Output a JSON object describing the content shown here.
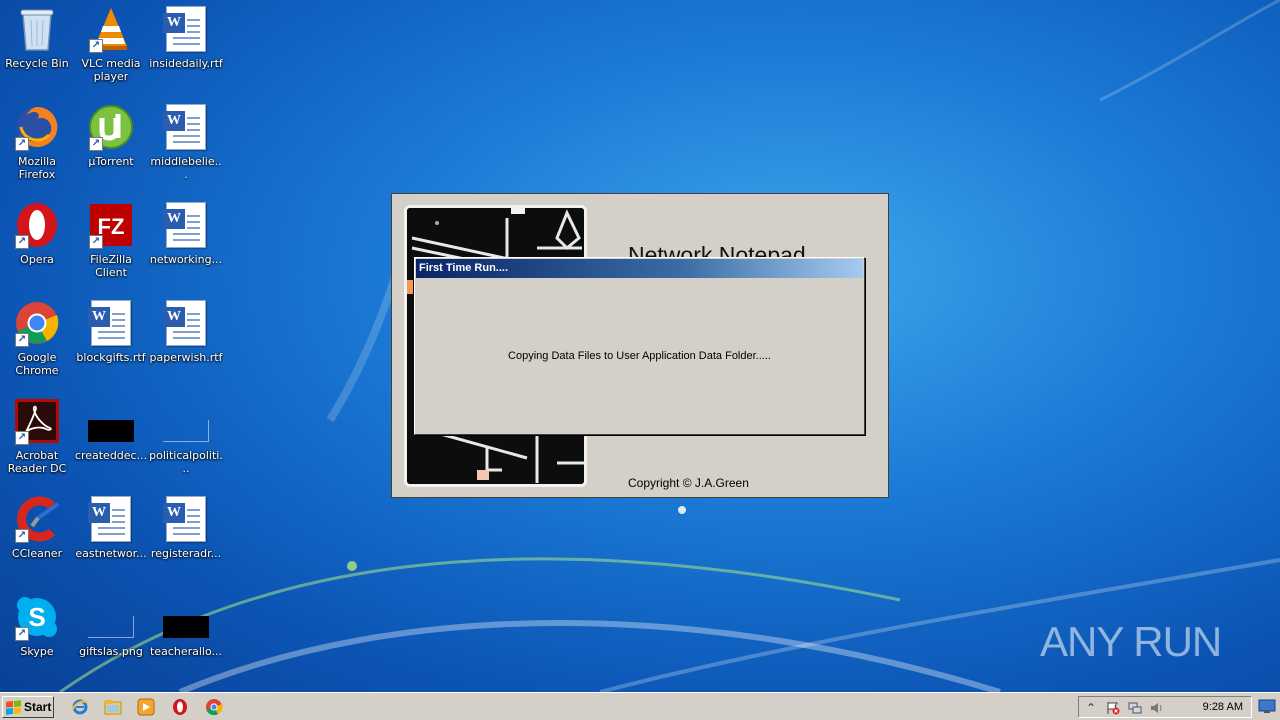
{
  "desktop": {
    "icons": [
      {
        "label": "Recycle Bin",
        "icon": "recycle-bin-icon"
      },
      {
        "label": "VLC media player",
        "icon": "vlc-icon"
      },
      {
        "label": "insidedaily.rtf",
        "icon": "word-document-icon"
      },
      {
        "label": "Mozilla Firefox",
        "icon": "firefox-icon"
      },
      {
        "label": "µTorrent",
        "icon": "utorrent-icon"
      },
      {
        "label": "middlebelie...",
        "icon": "word-document-icon"
      },
      {
        "label": "Opera",
        "icon": "opera-icon"
      },
      {
        "label": "FileZilla Client",
        "icon": "filezilla-icon"
      },
      {
        "label": "networking...",
        "icon": "word-document-icon"
      },
      {
        "label": "Google Chrome",
        "icon": "chrome-icon"
      },
      {
        "label": "blockgifts.rtf",
        "icon": "word-document-icon"
      },
      {
        "label": "paperwish.rtf",
        "icon": "word-document-icon"
      },
      {
        "label": "Acrobat Reader DC",
        "icon": "acrobat-icon"
      },
      {
        "label": "createddec...",
        "icon": "image-file-icon"
      },
      {
        "label": "politicalpoliti...",
        "icon": "image-file-icon"
      },
      {
        "label": "CCleaner",
        "icon": "ccleaner-icon"
      },
      {
        "label": "eastnetwor...",
        "icon": "word-document-icon"
      },
      {
        "label": "registeradr...",
        "icon": "word-document-icon"
      },
      {
        "label": "Skype",
        "icon": "skype-icon"
      },
      {
        "label": "giftslas.png",
        "icon": "image-file-icon"
      },
      {
        "label": "teacherallo...",
        "icon": "image-file-icon"
      }
    ]
  },
  "splash": {
    "title": "Network Notepad",
    "copyright": "Copyright ©  J.A.Green"
  },
  "dialog": {
    "title": "First Time Run....",
    "message": "Copying Data Files to User Application Data Folder....."
  },
  "watermark": {
    "text": "ANY RUN"
  },
  "taskbar": {
    "start_label": "Start",
    "quick_launch": [
      "internet-explorer-icon",
      "explorer-folder-icon",
      "media-player-icon",
      "opera-icon",
      "chrome-icon"
    ],
    "tray_icons": [
      "show-hidden-icons-icon",
      "action-center-flag-icon",
      "network-icon",
      "volume-icon"
    ],
    "clock": "9:28 AM"
  },
  "colors": {
    "dialog_title_start": "#0a246a",
    "dialog_title_end": "#a6caf0",
    "window_face": "#d4d0c8"
  }
}
